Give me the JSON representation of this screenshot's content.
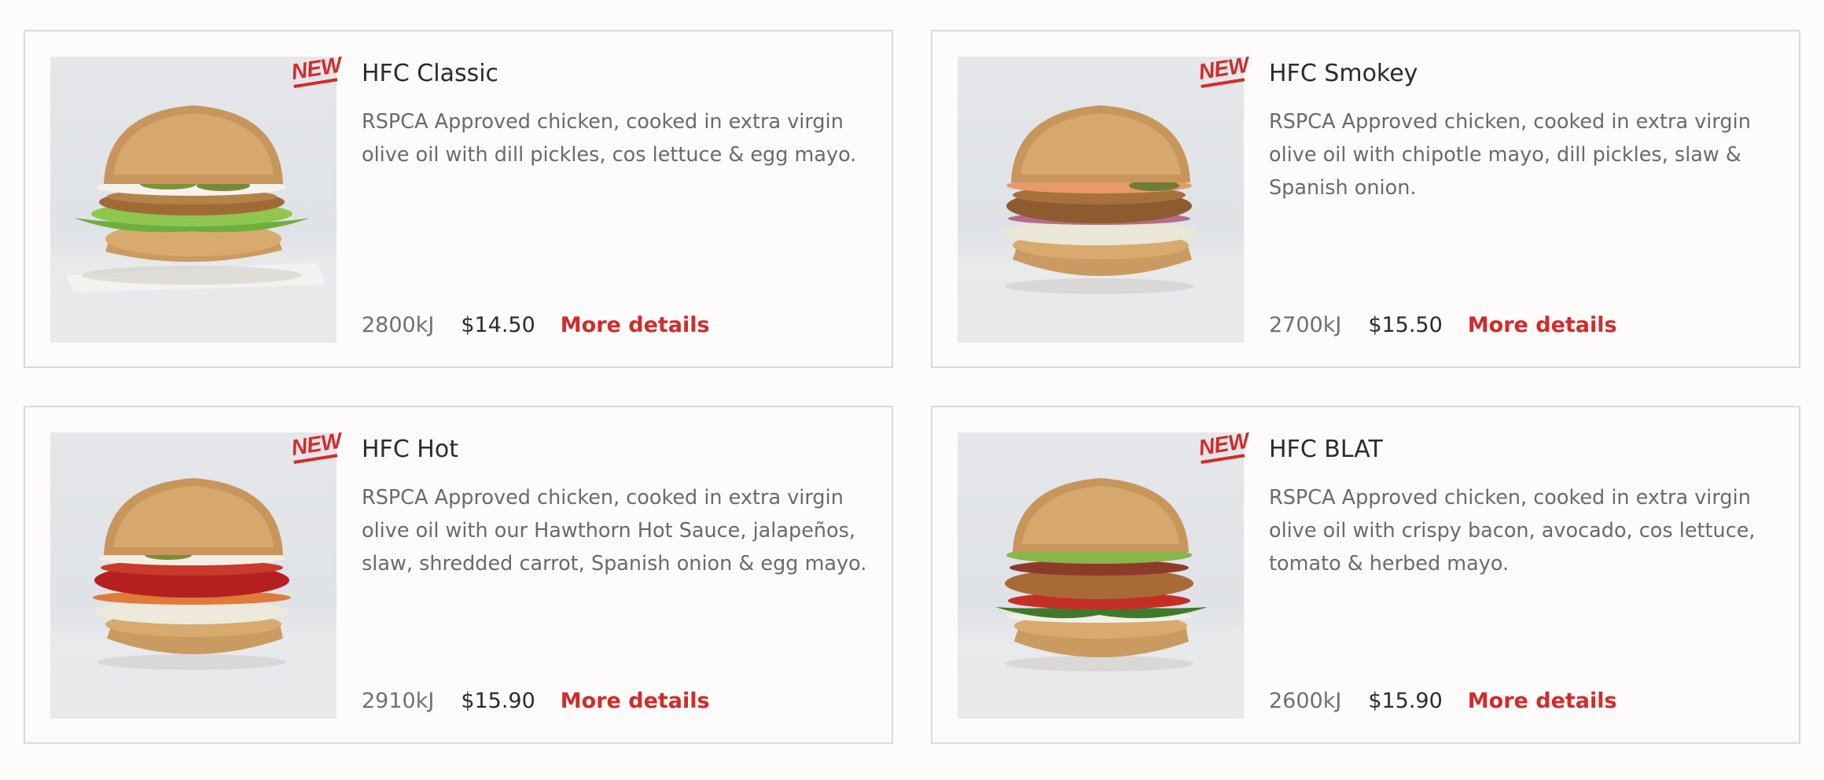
{
  "items": [
    {
      "badge": "NEW",
      "name": "HFC Classic",
      "description": "RSPCA Approved chicken, cooked in extra virgin olive oil with dill pickles, cos lettuce & egg mayo.",
      "energy": "2800kJ",
      "price": "$14.50",
      "link": "More details",
      "image": "burger-classic"
    },
    {
      "badge": "NEW",
      "name": "HFC Smokey",
      "description": "RSPCA Approved chicken, cooked in extra virgin olive oil with chipotle mayo, dill pickles, slaw & Spanish onion.",
      "energy": "2700kJ",
      "price": "$15.50",
      "link": "More details",
      "image": "burger-smokey"
    },
    {
      "badge": "NEW",
      "name": "HFC Hot",
      "description": "RSPCA Approved chicken, cooked in extra virgin olive oil with our Hawthorn Hot Sauce, jalapeños, slaw, shredded carrot, Spanish onion & egg mayo.",
      "energy": "2910kJ",
      "price": "$15.90",
      "link": "More details",
      "image": "burger-hot"
    },
    {
      "badge": "NEW",
      "name": "HFC BLAT",
      "description": "RSPCA Approved chicken, cooked in extra virgin olive oil with crispy bacon, avocado, cos lettuce, tomato & herbed mayo.",
      "energy": "2600kJ",
      "price": "$15.90",
      "link": "More details",
      "image": "burger-blat"
    }
  ],
  "colors": {
    "accent": "#d22b2b",
    "title": "#2b2b2b",
    "body": "#6a6a6a",
    "border": "#dcdad6",
    "background": "#fdfcfa"
  }
}
